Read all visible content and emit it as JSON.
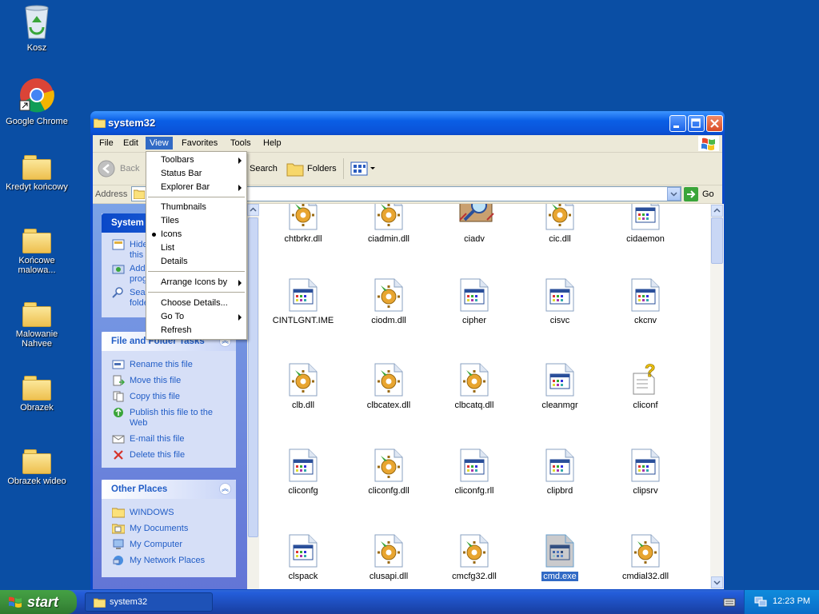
{
  "desktop": {
    "icons": [
      {
        "label": "Kosz"
      },
      {
        "label": "Google Chrome"
      },
      {
        "label": "Kredyt końcowy"
      },
      {
        "label": "Końcowe malowa..."
      },
      {
        "label": "Malowanie Nahvee"
      },
      {
        "label": "Obrazek"
      },
      {
        "label": "Obrazek wideo"
      }
    ]
  },
  "window": {
    "title": "system32",
    "menubar": [
      "File",
      "Edit",
      "View",
      "Favorites",
      "Tools",
      "Help"
    ],
    "active_menu": "View",
    "toolbar": {
      "back": "Back",
      "search": "Search",
      "folders": "Folders"
    },
    "address": {
      "label": "Address",
      "go": "Go"
    }
  },
  "view_menu": {
    "items": [
      "Toolbars",
      "Status Bar",
      "Explorer Bar",
      "Thumbnails",
      "Tiles",
      "Icons",
      "List",
      "Details",
      "Arrange Icons by",
      "Choose Details...",
      "Go To",
      "Refresh"
    ],
    "checked": "Icons"
  },
  "left_pane": {
    "system_tasks": {
      "title": "System",
      "items": [
        "Hide",
        "this",
        "Add",
        "prog",
        "Sear",
        "folde"
      ]
    },
    "file_tasks": {
      "title": "File and Folder Tasks",
      "items": [
        "Rename this file",
        "Move this file",
        "Copy this file",
        "Publish this file to the",
        "Web",
        "E-mail this file",
        "Delete this file"
      ]
    },
    "other_places": {
      "title": "Other Places",
      "items": [
        "WINDOWS",
        "My Documents",
        "My Computer",
        "My Network Places"
      ]
    }
  },
  "files": [
    {
      "name": "chtbrkr.dll",
      "icon": "dll-gear-icon"
    },
    {
      "name": "ciadmin.dll",
      "icon": "dll-gear-icon"
    },
    {
      "name": "ciadv",
      "icon": "search-app-icon"
    },
    {
      "name": "cic.dll",
      "icon": "dll-gear-icon"
    },
    {
      "name": "cidaemon",
      "icon": "exe-window-icon"
    },
    {
      "name": "CINTLGNT.IME",
      "icon": "exe-window-icon"
    },
    {
      "name": "ciodm.dll",
      "icon": "dll-gear-icon"
    },
    {
      "name": "cipher",
      "icon": "exe-window-icon"
    },
    {
      "name": "cisvc",
      "icon": "exe-window-icon"
    },
    {
      "name": "ckcnv",
      "icon": "exe-window-icon"
    },
    {
      "name": "clb.dll",
      "icon": "dll-gear-icon"
    },
    {
      "name": "clbcatex.dll",
      "icon": "dll-gear-icon"
    },
    {
      "name": "clbcatq.dll",
      "icon": "dll-gear-icon"
    },
    {
      "name": "cleanmgr",
      "icon": "exe-window-icon"
    },
    {
      "name": "cliconf",
      "icon": "help-file-icon"
    },
    {
      "name": "cliconfg",
      "icon": "exe-window-icon"
    },
    {
      "name": "cliconfg.dll",
      "icon": "dll-gear-icon"
    },
    {
      "name": "cliconfg.rll",
      "icon": "exe-window-icon"
    },
    {
      "name": "clipbrd",
      "icon": "exe-window-icon"
    },
    {
      "name": "clipsrv",
      "icon": "exe-window-icon"
    },
    {
      "name": "clspack",
      "icon": "exe-window-icon"
    },
    {
      "name": "clusapi.dll",
      "icon": "dll-gear-icon"
    },
    {
      "name": "cmcfg32.dll",
      "icon": "dll-gear-icon"
    },
    {
      "name": "cmd.exe",
      "icon": "exe-window-icon",
      "selected": true
    },
    {
      "name": "cmdial32.dll",
      "icon": "dll-gear-icon"
    }
  ],
  "taskbar": {
    "start": "start",
    "task": "system32",
    "clock": "12:23 PM"
  }
}
